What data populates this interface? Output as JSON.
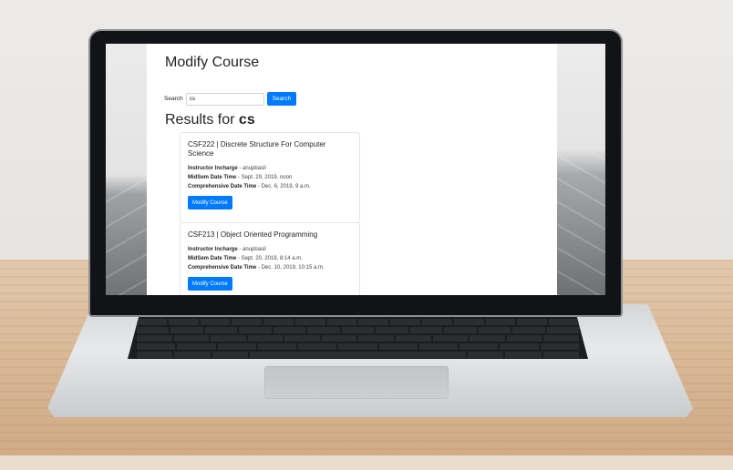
{
  "page": {
    "title": "Modify Course",
    "search": {
      "label": "Search",
      "value": "cs",
      "button_label": "Search"
    },
    "results": {
      "prefix": "Results for",
      "term": "cs"
    },
    "courses": [
      {
        "title": "CSF222 | Discrete Structure For Computer Science",
        "instructor_label": "Instructor Incharge",
        "instructor": "anupbasil",
        "midsem_label": "MidSem Date Time",
        "midsem": "Sept. 29, 2019, noon",
        "compre_label": "Comprehensive Date Time",
        "compre": "Dec. 6, 2019, 9 a.m.",
        "button_label": "Modify Course"
      },
      {
        "title": "CSF213 | Object Oriented Programming",
        "instructor_label": "Instructor Incharge",
        "instructor": "anupbasil",
        "midsem_label": "MidSem Date Time",
        "midsem": "Sept. 20, 2019, 8:14 a.m.",
        "compre_label": "Comprehensive Date Time",
        "compre": "Dec. 10, 2019, 10:15 a.m.",
        "button_label": "Modify Course"
      }
    ]
  },
  "colors": {
    "primary": "#007bff",
    "text": "#212529",
    "card_border": "#e3e6e9"
  }
}
